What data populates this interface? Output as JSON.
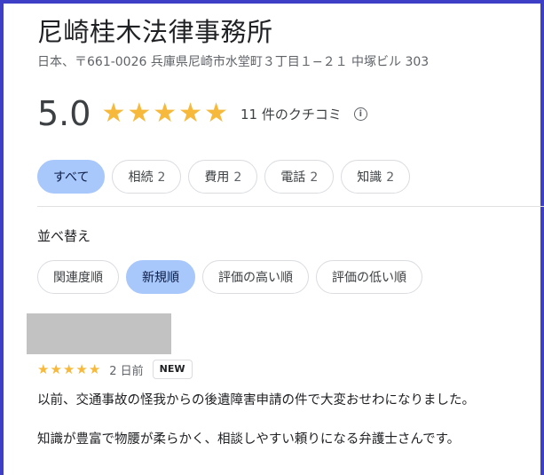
{
  "business": {
    "name": "尼崎桂木法律事務所",
    "address": "日本、〒661-0026 兵庫県尼崎市水堂町３丁目１−２１ 中塚ビル 303"
  },
  "rating": {
    "score": "5.0",
    "stars": 5,
    "review_count_text": "11 件のクチコミ",
    "info_icon": "info-icon"
  },
  "filters": [
    {
      "label": "すべて",
      "count": "",
      "active": true
    },
    {
      "label": "相続",
      "count": "2",
      "active": false
    },
    {
      "label": "費用",
      "count": "2",
      "active": false
    },
    {
      "label": "電話",
      "count": "2",
      "active": false
    },
    {
      "label": "知識",
      "count": "2",
      "active": false
    }
  ],
  "sort": {
    "label": "並べ替え",
    "options": [
      {
        "label": "関連度順",
        "active": false
      },
      {
        "label": "新規順",
        "active": true
      },
      {
        "label": "評価の高い順",
        "active": false
      },
      {
        "label": "評価の低い順",
        "active": false
      }
    ]
  },
  "review": {
    "stars": 5,
    "date": "2 日前",
    "badge": "NEW",
    "paragraphs": [
      "以前、交通事故の怪我からの後遺障害申請の件で大変おせわになりました。",
      "知識が豊富で物腰が柔らかく、相談しやすい頼りになる弁護士さんです。"
    ]
  },
  "colors": {
    "frame": "#3d3fc6",
    "star": "#f6b93b",
    "chip_active": "#a8c7fa",
    "redacted_block": "#c2c2c2"
  }
}
